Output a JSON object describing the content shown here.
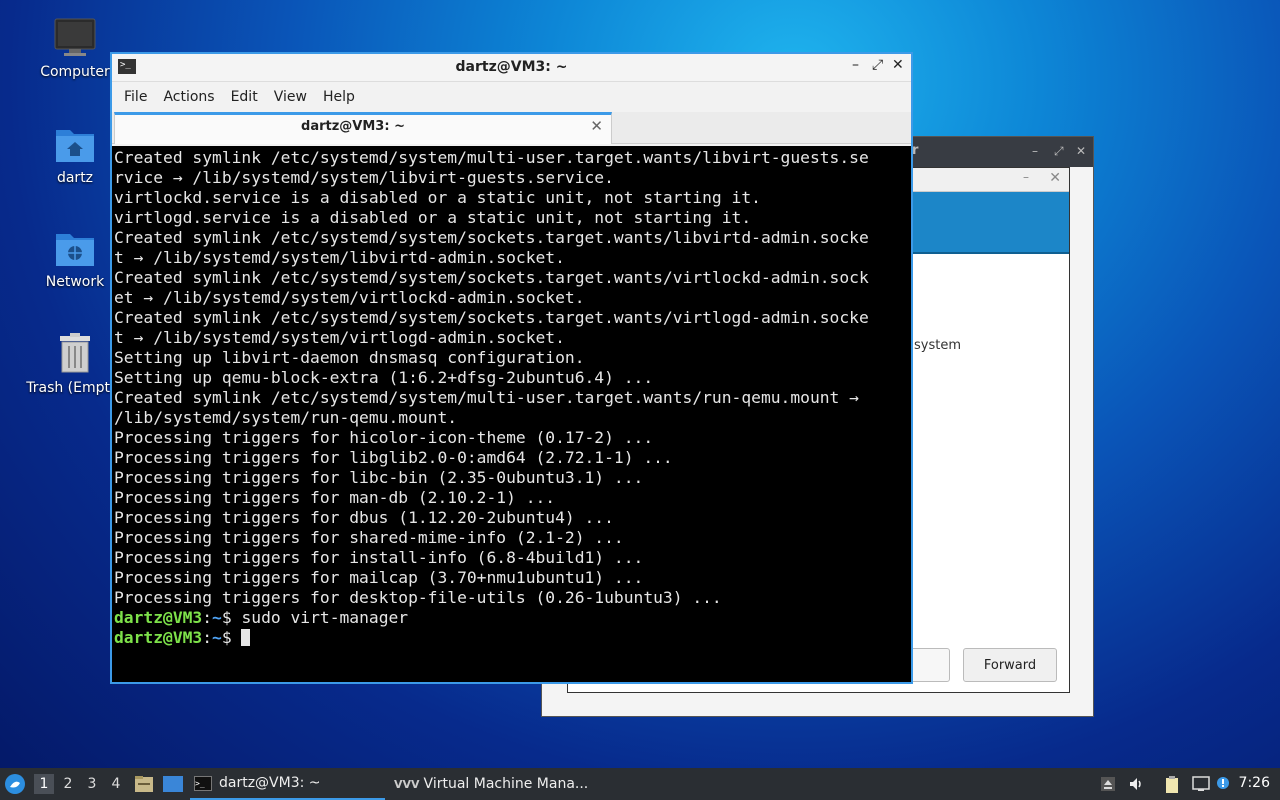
{
  "desktop": {
    "icons": [
      {
        "label": "Computer"
      },
      {
        "label": "dartz"
      },
      {
        "label": "Network"
      },
      {
        "label": "Trash (Empty)"
      }
    ]
  },
  "vmm_window": {
    "title": "r",
    "partial_text": "system",
    "forward_label": "Forward"
  },
  "terminal": {
    "title": "dartz@VM3: ~",
    "tab_label": "dartz@VM3: ~",
    "menu": [
      "File",
      "Actions",
      "Edit",
      "View",
      "Help"
    ],
    "output": [
      "Created symlink /etc/systemd/system/multi-user.target.wants/libvirt-guests.se",
      "rvice → /lib/systemd/system/libvirt-guests.service.",
      "virtlockd.service is a disabled or a static unit, not starting it.",
      "virtlogd.service is a disabled or a static unit, not starting it.",
      "Created symlink /etc/systemd/system/sockets.target.wants/libvirtd-admin.socke",
      "t → /lib/systemd/system/libvirtd-admin.socket.",
      "Created symlink /etc/systemd/system/sockets.target.wants/virtlockd-admin.sock",
      "et → /lib/systemd/system/virtlockd-admin.socket.",
      "Created symlink /etc/systemd/system/sockets.target.wants/virtlogd-admin.socke",
      "t → /lib/systemd/system/virtlogd-admin.socket.",
      "Setting up libvirt-daemon dnsmasq configuration.",
      "Setting up qemu-block-extra (1:6.2+dfsg-2ubuntu6.4) ...",
      "Created symlink /etc/systemd/system/multi-user.target.wants/run-qemu.mount →",
      "/lib/systemd/system/run-qemu.mount.",
      "Processing triggers for hicolor-icon-theme (0.17-2) ...",
      "Processing triggers for libglib2.0-0:amd64 (2.72.1-1) ...",
      "Processing triggers for libc-bin (2.35-0ubuntu3.1) ...",
      "Processing triggers for man-db (2.10.2-1) ...",
      "Processing triggers for dbus (1.12.20-2ubuntu4) ...",
      "Processing triggers for shared-mime-info (2.1-2) ...",
      "Processing triggers for install-info (6.8-4build1) ...",
      "Processing triggers for mailcap (3.70+nmu1ubuntu1) ...",
      "Processing triggers for desktop-file-utils (0.26-1ubuntu3) ..."
    ],
    "prompt_user": "dartz@VM3",
    "prompt_sep": ":",
    "prompt_path": "~",
    "prompt_dollar": "$ ",
    "command": "sudo virt-manager"
  },
  "taskbar": {
    "workspaces": [
      "1",
      "2",
      "3",
      "4"
    ],
    "tasks": [
      {
        "label": "dartz@VM3: ~",
        "icon": "terminal-icon"
      },
      {
        "label": "Virtual Machine Mana...",
        "icon": "virt-manager-icon"
      }
    ],
    "clock": "7:26"
  },
  "colors": {
    "accent": "#3c9ae8",
    "prompt_user": "#7ee24a",
    "prompt_path": "#4fa3f5",
    "taskbar_bg": "#2a2e33"
  }
}
